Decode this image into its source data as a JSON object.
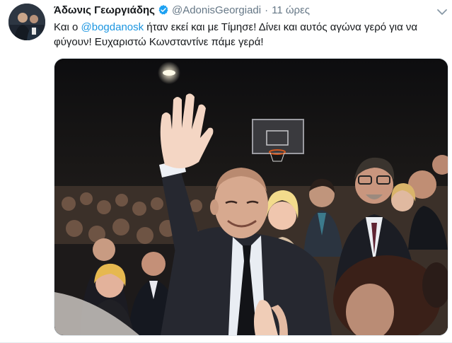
{
  "tweet": {
    "display_name": "Άδωνις Γεωργιάδης",
    "handle": "@AdonisGeorgiadi",
    "separator": "·",
    "time": "11 ώρες",
    "text_before": "Και ο ",
    "mention": "@bogdanosk",
    "text_after": " ήταν εκεί και με Τίμησε! Δίνει και αυτός αγώνα γερό για να φύγουν! Ευχαριστώ Κωνσταντίνε πάμε γερά!"
  },
  "colors": {
    "verified_badge": "#1da1f2",
    "mention": "#1b95e0",
    "secondary_text": "#657786",
    "primary_text": "#14171a"
  },
  "icons": {
    "verified": "verified-badge-icon",
    "menu": "chevron-down-icon"
  }
}
